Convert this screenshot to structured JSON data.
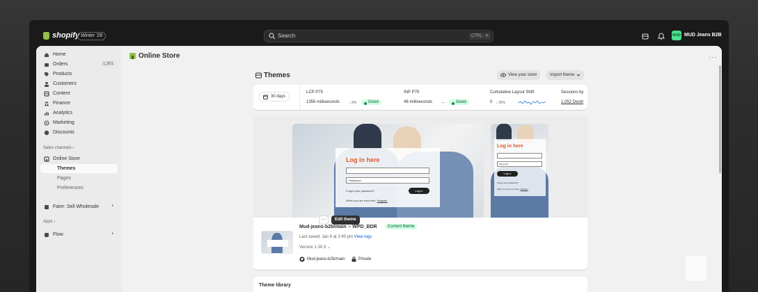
{
  "topbar": {
    "brand": "shopify",
    "edition_badge": "Winter '26",
    "search_placeholder": "Search",
    "kbd_ctrl": "CTRL",
    "kbd_k": "K",
    "store_avatar": "MUD",
    "store_name": "MUD Jeans B2B"
  },
  "sidebar": {
    "items": [
      {
        "label": "Home",
        "icon": "home-icon"
      },
      {
        "label": "Orders",
        "icon": "orders-icon",
        "count": "1,301"
      },
      {
        "label": "Products",
        "icon": "tag-icon"
      },
      {
        "label": "Customers",
        "icon": "person-icon"
      },
      {
        "label": "Content",
        "icon": "content-icon"
      },
      {
        "label": "Finance",
        "icon": "bank-icon"
      },
      {
        "label": "Analytics",
        "icon": "chart-icon"
      },
      {
        "label": "Marketing",
        "icon": "target-icon"
      },
      {
        "label": "Discounts",
        "icon": "discount-icon"
      }
    ],
    "sales_channels_label": "Sales channels ›",
    "online_store": "Online Store",
    "sub_items": [
      "Themes",
      "Pages",
      "Preferences"
    ],
    "faire_app": "Faire: Sell Wholesale",
    "apps_label": "Apps ›",
    "flow_app": "Flow"
  },
  "page": {
    "title": "Online Store",
    "more": "···"
  },
  "themes": {
    "title": "Themes",
    "view_store": "View your store",
    "import_theme": "Import theme"
  },
  "metrics": {
    "days": "30 days",
    "lcp_label": "LCP P75",
    "lcp_value": "1356 milliseconds",
    "lcp_change": "↓ 9%",
    "lcp_status": "Good",
    "inp_label": "INP P75",
    "inp_value": "48 milliseconds",
    "inp_change": "—",
    "inp_status": "Good",
    "cls_label": "Cumulative Layout Shift",
    "cls_value": "0",
    "cls_change": "↓ 25%",
    "sessions_label": "Sessions by",
    "sessions_value": "1,052 Deskt"
  },
  "preview": {
    "login_title": "Log in here",
    "password_placeholder": "Password",
    "forgot": "Forgot your password?",
    "login_btn": "Log in",
    "new_here": "When you are new here,",
    "register": "Register"
  },
  "current_theme": {
    "name": "Mud-jeans-b2b/main -- WPD_BDR",
    "badge": "Current theme",
    "saved": "Last saved: Jan 9 at 2:40 pm",
    "view_logs": "View logs",
    "version": "Version 1.30.3",
    "repo": "Mud-jeans-b2b/main",
    "privacy": "Private",
    "more": "···",
    "edit": "Edit theme"
  },
  "library": {
    "title": "Theme library"
  },
  "colors": {
    "accent_green": "#95bf47",
    "good_badge": "#cdfee1",
    "link": "#005bd3",
    "login_accent": "#e0582b"
  }
}
